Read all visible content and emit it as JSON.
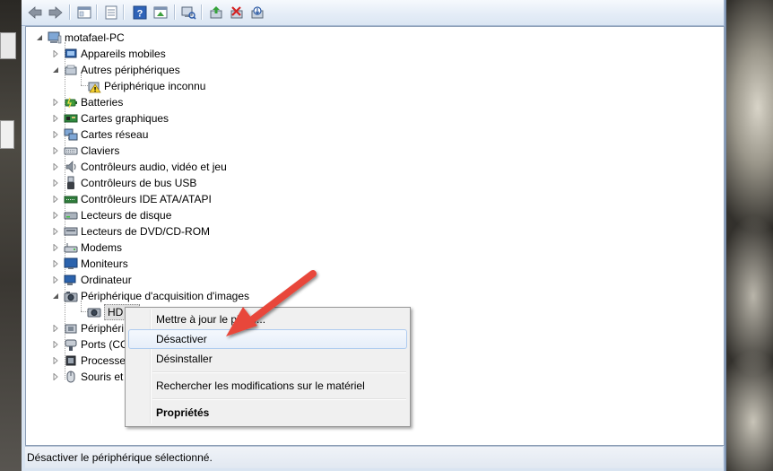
{
  "status_bar": {
    "text": "Désactiver le périphérique sélectionné."
  },
  "toolbar": {
    "buttons": [
      "back-icon",
      "forward-icon",
      "up-icon",
      "properties-icon",
      "help-icon",
      "console-tree-icon",
      "scan-hardware-icon",
      "update-driver-icon",
      "uninstall-icon",
      "disable-icon"
    ]
  },
  "tree": {
    "root": "motafael-PC",
    "items": [
      {
        "label": "Appareils mobiles",
        "icon": "mobile-devices-icon"
      },
      {
        "label": "Autres périphériques",
        "icon": "other-devices-icon",
        "expanded": true
      },
      {
        "label": "Périphérique inconnu",
        "icon": "unknown-device-warning-icon",
        "child": true
      },
      {
        "label": "Batteries",
        "icon": "battery-icon"
      },
      {
        "label": "Cartes graphiques",
        "icon": "display-adapter-icon"
      },
      {
        "label": "Cartes réseau",
        "icon": "network-adapter-icon"
      },
      {
        "label": "Claviers",
        "icon": "keyboard-icon"
      },
      {
        "label": "Contrôleurs audio, vidéo et jeu",
        "icon": "audio-icon"
      },
      {
        "label": "Contrôleurs de bus USB",
        "icon": "usb-icon"
      },
      {
        "label": "Contrôleurs IDE ATA/ATAPI",
        "icon": "ide-icon"
      },
      {
        "label": "Lecteurs de disque",
        "icon": "disk-drive-icon"
      },
      {
        "label": "Lecteurs de DVD/CD-ROM",
        "icon": "dvd-icon"
      },
      {
        "label": "Modems",
        "icon": "modem-icon"
      },
      {
        "label": "Moniteurs",
        "icon": "monitor-icon"
      },
      {
        "label": "Ordinateur",
        "icon": "computer-icon"
      },
      {
        "label": "Périphérique d'acquisition d'images",
        "icon": "imaging-icon",
        "expanded": true
      },
      {
        "label": "HD W",
        "icon": "webcam-icon",
        "child": true,
        "selected": true
      },
      {
        "label": "Périphéri",
        "icon": "hid-icon"
      },
      {
        "label": "Ports (CC",
        "icon": "ports-icon"
      },
      {
        "label": "Processe",
        "icon": "processor-icon"
      },
      {
        "label": "Souris et",
        "icon": "mouse-icon"
      }
    ]
  },
  "context_menu": {
    "items": [
      {
        "label": "Mettre à jour le pilote..."
      },
      {
        "label": "Désactiver",
        "highlighted": true
      },
      {
        "label": "Désinstaller"
      },
      {
        "label": "Rechercher les modifications sur le matériel"
      },
      {
        "label": "Propriétés",
        "bold": true
      }
    ]
  },
  "annotation": {
    "arrow_color": "#e8473a"
  }
}
